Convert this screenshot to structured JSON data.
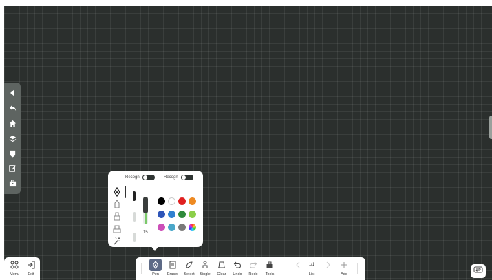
{
  "recognition": {
    "label_1": "Recogn",
    "label_2": "Recogn"
  },
  "pen_size": "15",
  "colors": [
    "#000000",
    "#ffffff",
    "#e02020",
    "#ee8a22",
    "#2e55b8",
    "#2f80d0",
    "#2f8a3b",
    "#8ccf4a",
    "#cc4fb8",
    "#4aa7c9",
    "#7a7a7a",
    "rainbow"
  ],
  "bottom_left": {
    "menu_label": "Menu",
    "exit_label": "Exit"
  },
  "toolbar": {
    "tools": [
      {
        "label": "Pen",
        "icon": "pen-icon"
      },
      {
        "label": "Eraser",
        "icon": "eraser-icon"
      },
      {
        "label": "Select",
        "icon": "select-icon"
      },
      {
        "label": "Single",
        "icon": "single-icon"
      },
      {
        "label": "Clear",
        "icon": "clear-icon"
      },
      {
        "label": "Undo",
        "icon": "undo-icon"
      },
      {
        "label": "Redo",
        "icon": "redo-icon"
      },
      {
        "label": "Tools",
        "icon": "tools-icon"
      }
    ],
    "page_indicator": "1/1",
    "list_label": "List",
    "add_label": "Add"
  },
  "left_rail_icons": [
    "collapse-arrow-icon",
    "back-icon",
    "home-icon",
    "layers-icon",
    "shield-icon",
    "edit-icon",
    "briefcase-icon"
  ]
}
